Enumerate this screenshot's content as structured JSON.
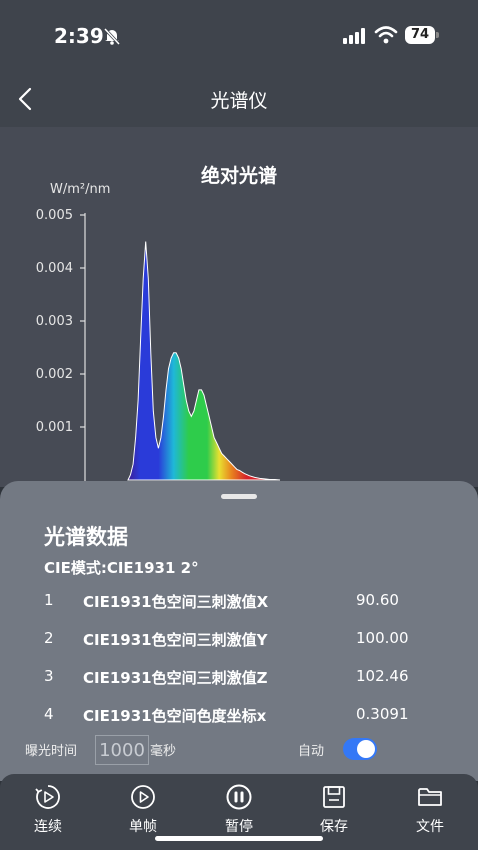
{
  "status_bar": {
    "time": "2:39",
    "battery": "74"
  },
  "nav": {
    "title": "光谱仪"
  },
  "chart_data": {
    "type": "area",
    "title": "绝对光谱",
    "ylabel": "W/m²/nm",
    "y_ticks": [
      "0.001",
      "0.002",
      "0.003",
      "0.004",
      "0.005"
    ],
    "ylim": [
      0,
      0.005
    ],
    "x": [
      400,
      405,
      410,
      415,
      420,
      425,
      430,
      435,
      440,
      445,
      450,
      455,
      460,
      465,
      470,
      475,
      480,
      485,
      490,
      495,
      500,
      505,
      510,
      515,
      520,
      525,
      530,
      535,
      540,
      545,
      550,
      555,
      560,
      565,
      570,
      575,
      580,
      585,
      590,
      595,
      600,
      605,
      610,
      615,
      620,
      625,
      630,
      640,
      650,
      660,
      670,
      680,
      690,
      700
    ],
    "values": [
      0,
      0.0001,
      0.0003,
      0.0008,
      0.0015,
      0.0027,
      0.0038,
      0.0045,
      0.0038,
      0.0024,
      0.0013,
      0.0008,
      0.0006,
      0.0008,
      0.0012,
      0.0017,
      0.0021,
      0.0023,
      0.0024,
      0.0024,
      0.0023,
      0.0021,
      0.0018,
      0.0015,
      0.0013,
      0.0012,
      0.0013,
      0.0015,
      0.0017,
      0.0017,
      0.0016,
      0.0014,
      0.0012,
      0.001,
      0.0008,
      0.0007,
      0.0006,
      0.0005,
      0.00045,
      0.0004,
      0.00035,
      0.0003,
      0.00025,
      0.0002,
      0.00018,
      0.00015,
      0.00012,
      8e-05,
      5e-05,
      3e-05,
      2e-05,
      1e-05,
      1e-05,
      0
    ],
    "colors": {
      "violet": "#3c1e96",
      "blue": "#2a3bd9",
      "cyan": "#1fb8d8",
      "green": "#2ecc4b",
      "yellow": "#e8e031",
      "orange": "#e8841f",
      "red": "#d6232a"
    }
  },
  "sheet": {
    "title": "光谱数据",
    "cie_mode": "CIE模式:CIE1931 2°",
    "rows": [
      {
        "index": "1",
        "label": "CIE1931色空间三刺激值X",
        "value": "90.60"
      },
      {
        "index": "2",
        "label": "CIE1931色空间三刺激值Y",
        "value": "100.00"
      },
      {
        "index": "3",
        "label": "CIE1931色空间三刺激值Z",
        "value": "102.46"
      },
      {
        "index": "4",
        "label": "CIE1931色空间色度坐标x",
        "value": "0.3091"
      }
    ],
    "exposure_label": "曝光时间",
    "exposure_value": "1000",
    "exposure_unit": "毫秒",
    "auto_label": "自动",
    "auto_on": true
  },
  "bottom_bar": {
    "items": [
      {
        "label": "连续",
        "icon": "continuous-play-icon"
      },
      {
        "label": "单帧",
        "icon": "play-icon"
      },
      {
        "label": "暂停",
        "icon": "pause-icon"
      },
      {
        "label": "保存",
        "icon": "save-icon"
      },
      {
        "label": "文件",
        "icon": "folder-icon"
      }
    ]
  }
}
